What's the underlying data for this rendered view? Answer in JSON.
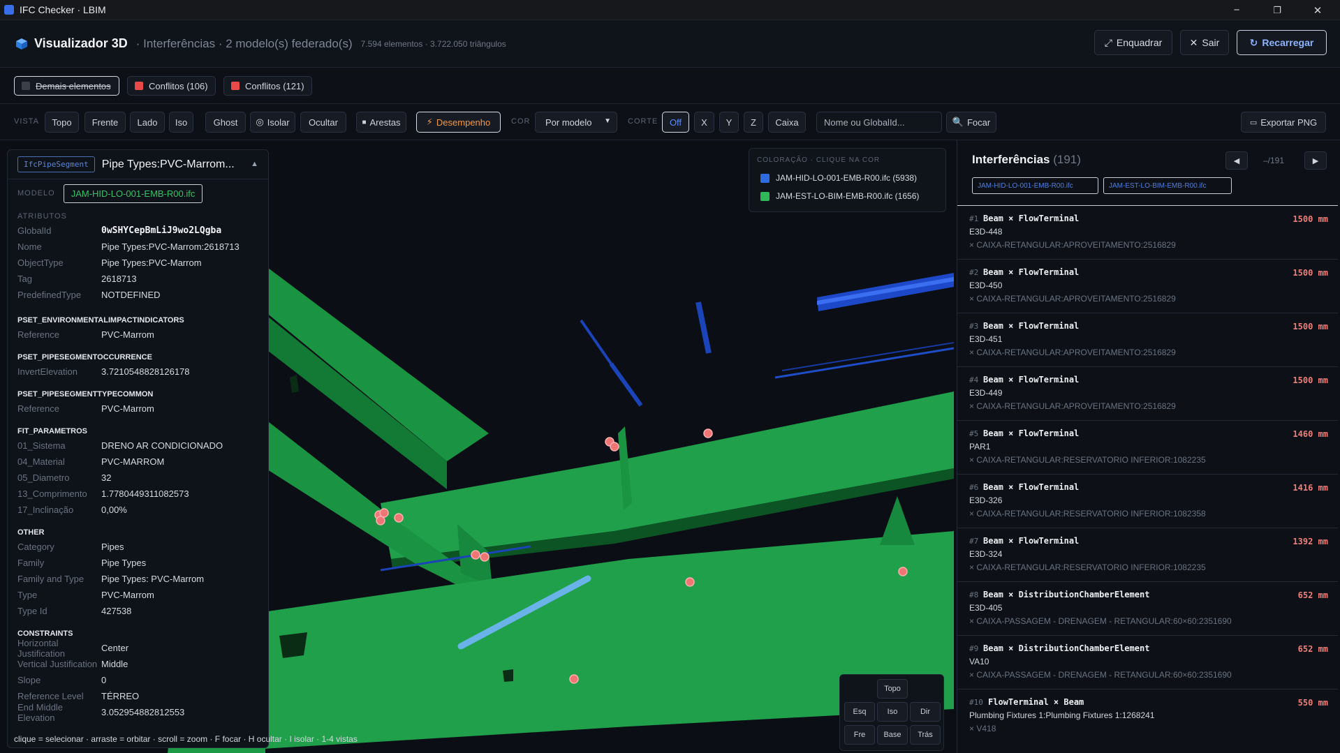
{
  "window": {
    "title": "IFC Checker · LBIM",
    "minimize": "−",
    "restore": "❐",
    "close": "✕"
  },
  "header": {
    "title": "Visualizador 3D",
    "subtitle": "· Interferências · 2 modelo(s) federado(s)",
    "stats": "7.594 elementos · 3.722.050 triângulos",
    "fit_label": "Enquadrar",
    "exit_label": "Sair",
    "reload_label": "Recarregar"
  },
  "layers": [
    {
      "label": "Demais elementos",
      "color": "#3a3f48",
      "hidden": true
    },
    {
      "label": "Conflitos (106)",
      "color": "#e84a4a",
      "hidden": false
    },
    {
      "label": "Conflitos (121)",
      "color": "#e84a4a",
      "hidden": false
    }
  ],
  "toolbar": {
    "view_label": "VISTA",
    "views": [
      "Topo",
      "Frente",
      "Lado",
      "Iso"
    ],
    "ghost": "Ghost",
    "isolate": "Isolar",
    "hide": "Ocultar",
    "edges": "Arestas",
    "performance": "Desempenho",
    "color_label": "COR",
    "color_select": "Por modelo",
    "cut_label": "CORTE",
    "cuts": [
      "Off",
      "X",
      "Y",
      "Z",
      "Caixa"
    ],
    "search_placeholder": "Nome ou GlobalId...",
    "focus": "Focar",
    "export": "Exportar PNG"
  },
  "props": {
    "type": "IfcPipeSegment",
    "title": "Pipe Types:PVC-Marrom...",
    "model_label": "MODELO",
    "model": "JAM-HID-LO-001-EMB-R00.ifc",
    "sections": [
      {
        "name": "ATRIBUTOS",
        "style": "plain",
        "rows": [
          {
            "k": "GlobalId",
            "v": "0wSHYCepBmLiJ9wo2LQgba",
            "gid": true
          },
          {
            "k": "Nome",
            "v": "Pipe Types:PVC-Marrom:2618713"
          },
          {
            "k": "ObjectType",
            "v": "Pipe Types:PVC-Marrom"
          },
          {
            "k": "Tag",
            "v": "2618713"
          },
          {
            "k": "PredefinedType",
            "v": "NOTDEFINED"
          }
        ]
      },
      {
        "name": "PSET_ENVIRONMENTALIMPACTINDICATORS",
        "rows": [
          {
            "k": "Reference",
            "v": "PVC-Marrom"
          }
        ]
      },
      {
        "name": "PSET_PIPESEGMENTOCCURRENCE",
        "rows": [
          {
            "k": "InvertElevation",
            "v": "3.7210548828126178"
          }
        ]
      },
      {
        "name": "PSET_PIPESEGMENTTYPECOMMON",
        "rows": [
          {
            "k": "Reference",
            "v": "PVC-Marrom"
          }
        ]
      },
      {
        "name": "FIT_PARAMETROS",
        "rows": [
          {
            "k": "01_Sistema",
            "v": "DRENO AR CONDICIONADO"
          },
          {
            "k": "04_Material",
            "v": "PVC-MARROM"
          },
          {
            "k": "05_Diametro",
            "v": "32"
          },
          {
            "k": "13_Comprimento",
            "v": "1.7780449311082573"
          },
          {
            "k": "17_Inclinação",
            "v": "0,00%"
          }
        ]
      },
      {
        "name": "OTHER",
        "rows": [
          {
            "k": "Category",
            "v": "Pipes"
          },
          {
            "k": "Family",
            "v": "Pipe Types"
          },
          {
            "k": "Family and Type",
            "v": "Pipe Types: PVC-Marrom"
          },
          {
            "k": "Type",
            "v": "PVC-Marrom"
          },
          {
            "k": "Type Id",
            "v": "427538"
          }
        ]
      },
      {
        "name": "CONSTRAINTS",
        "rows": [
          {
            "k": "Horizontal Justification",
            "v": "Center"
          },
          {
            "k": "Vertical Justification",
            "v": "Middle"
          },
          {
            "k": "Slope",
            "v": "0"
          },
          {
            "k": "Reference Level",
            "v": "TÉRREO"
          },
          {
            "k": "End Middle Elevation",
            "v": "3.052954882812553"
          }
        ]
      }
    ]
  },
  "legend": {
    "title": "COLORAÇÃO · CLIQUE NA COR",
    "items": [
      {
        "label": "JAM-HID-LO-001-EMB-R00.ifc (5938)",
        "color": "#2f6be0"
      },
      {
        "label": "JAM-EST-LO-BIM-EMB-R00.ifc (1656)",
        "color": "#2fb85a"
      }
    ]
  },
  "viewcube": {
    "top": "Topo",
    "left": "Esq",
    "iso": "Iso",
    "right": "Dir",
    "front": "Fre",
    "base": "Base",
    "back": "Trás"
  },
  "hint": "clique = selecionar · arraste = orbitar · scroll = zoom · F focar · H ocultar · I isolar · 1-4 vistas",
  "interferences": {
    "title": "Interferências",
    "count": "(191)",
    "page": "–/191",
    "filters": [
      "JAM-HID-LO-001-EMB-R00.ifc",
      "JAM-EST-LO-BIM-EMB-R00.ifc"
    ],
    "items": [
      {
        "num": "#1",
        "title": "Beam × FlowTerminal",
        "mm": "1500 mm",
        "a": "E3D-448",
        "b": "× CAIXA-RETANGULAR:APROVEITAMENTO:2516829"
      },
      {
        "num": "#2",
        "title": "Beam × FlowTerminal",
        "mm": "1500 mm",
        "a": "E3D-450",
        "b": "× CAIXA-RETANGULAR:APROVEITAMENTO:2516829"
      },
      {
        "num": "#3",
        "title": "Beam × FlowTerminal",
        "mm": "1500 mm",
        "a": "E3D-451",
        "b": "× CAIXA-RETANGULAR:APROVEITAMENTO:2516829"
      },
      {
        "num": "#4",
        "title": "Beam × FlowTerminal",
        "mm": "1500 mm",
        "a": "E3D-449",
        "b": "× CAIXA-RETANGULAR:APROVEITAMENTO:2516829"
      },
      {
        "num": "#5",
        "title": "Beam × FlowTerminal",
        "mm": "1460 mm",
        "a": "PAR1",
        "b": "× CAIXA-RETANGULAR:RESERVATORIO INFERIOR:1082235"
      },
      {
        "num": "#6",
        "title": "Beam × FlowTerminal",
        "mm": "1416 mm",
        "a": "E3D-326",
        "b": "× CAIXA-RETANGULAR:RESERVATORIO INFERIOR:1082358"
      },
      {
        "num": "#7",
        "title": "Beam × FlowTerminal",
        "mm": "1392 mm",
        "a": "E3D-324",
        "b": "× CAIXA-RETANGULAR:RESERVATORIO INFERIOR:1082235"
      },
      {
        "num": "#8",
        "title": "Beam × DistributionChamberElement",
        "mm": "652 mm",
        "a": "E3D-405",
        "b": "× CAIXA-PASSAGEM - DRENAGEM - RETANGULAR:60×60:2351690"
      },
      {
        "num": "#9",
        "title": "Beam × DistributionChamberElement",
        "mm": "652 mm",
        "a": "VA10",
        "b": "× CAIXA-PASSAGEM - DRENAGEM - RETANGULAR:60×60:2351690"
      },
      {
        "num": "#10",
        "title": "FlowTerminal × Beam",
        "mm": "550 mm",
        "a": "Plumbing Fixtures 1:Plumbing Fixtures 1:1268241",
        "b": "× V418"
      }
    ]
  }
}
